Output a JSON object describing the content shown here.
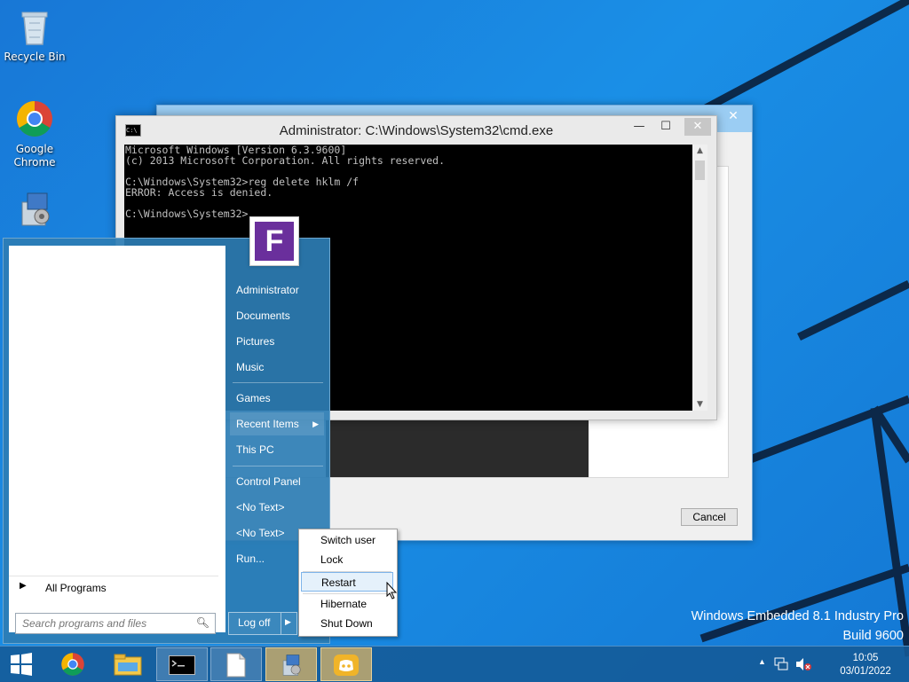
{
  "desktop": {
    "icons": [
      {
        "label": "Recycle Bin",
        "icon": "recycle-bin-icon"
      },
      {
        "label": "Google Chrome",
        "icon": "chrome-icon"
      },
      {
        "label": "",
        "icon": "installer-package-icon"
      }
    ],
    "branding": {
      "line1": "Windows Embedded 8.1 Industry Pro",
      "line2": "Build 9600"
    }
  },
  "background_dialog": {
    "cancel_label": "Cancel"
  },
  "cmd_window": {
    "title": "Administrator: C:\\Windows\\System32\\cmd.exe",
    "lines": [
      "Microsoft Windows [Version 6.3.9600]",
      "(c) 2013 Microsoft Corporation. All rights reserved.",
      "",
      "C:\\Windows\\System32>reg delete hklm /f",
      "ERROR: Access is denied.",
      "",
      "C:\\Windows\\System32>"
    ]
  },
  "start_menu": {
    "all_programs": "All Programs",
    "search_placeholder": "Search programs and files",
    "right_items": [
      {
        "label": "Administrator"
      },
      {
        "label": "Documents"
      },
      {
        "label": "Pictures"
      },
      {
        "label": "Music"
      },
      {
        "label": "Games"
      },
      {
        "label": "Recent Items",
        "submenu": true
      },
      {
        "label": "This PC"
      },
      {
        "label": "Control Panel"
      },
      {
        "label": "<No Text>"
      },
      {
        "label": "<No Text>"
      },
      {
        "label": "Run..."
      }
    ],
    "logoff_label": "Log off",
    "user_tile_letter": "F"
  },
  "shutdown_menu": {
    "items": [
      "Switch user",
      "Lock",
      "Restart",
      "Hibernate",
      "Shut Down"
    ],
    "hovered": "Restart"
  },
  "taskbar": {
    "buttons": [
      {
        "icon": "windows-start-icon"
      },
      {
        "icon": "chrome-icon"
      },
      {
        "icon": "file-explorer-icon"
      },
      {
        "icon": "command-prompt-icon"
      },
      {
        "icon": "blank-document-icon"
      },
      {
        "icon": "installer-package-icon"
      },
      {
        "icon": "discord-icon"
      }
    ],
    "clock_time": "10:05",
    "clock_date": "03/01/2022"
  }
}
